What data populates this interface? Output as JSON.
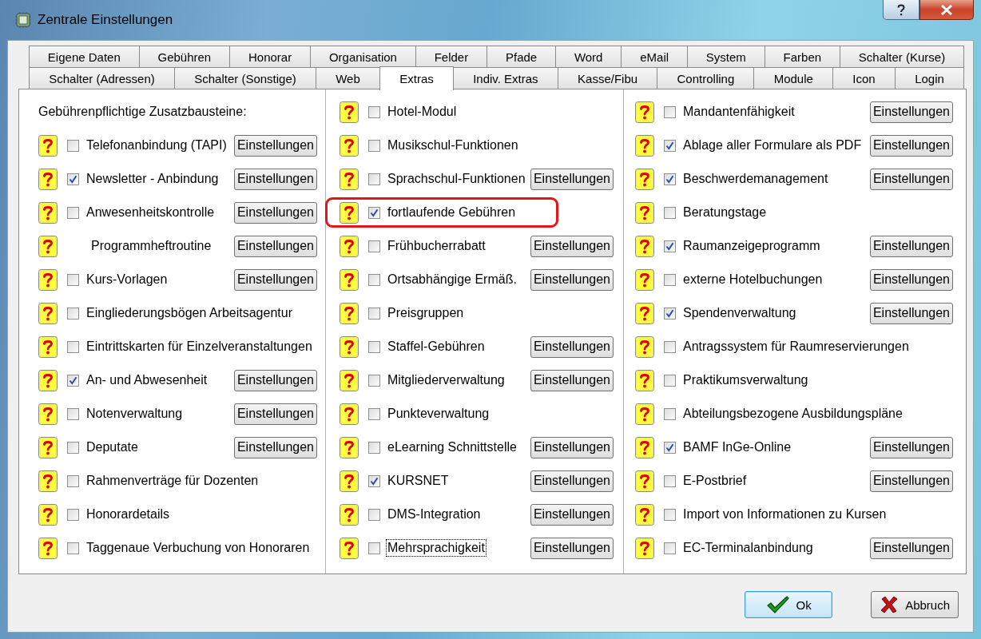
{
  "window": {
    "title": "Zentrale Einstellungen"
  },
  "tabs": [
    [
      {
        "label": "Eigene Daten",
        "selected": false
      },
      {
        "label": "Gebühren",
        "selected": false
      },
      {
        "label": "Honorar",
        "selected": false
      },
      {
        "label": "Organisation",
        "selected": false
      },
      {
        "label": "Felder",
        "selected": false
      },
      {
        "label": "Pfade",
        "selected": false
      },
      {
        "label": "Word",
        "selected": false
      },
      {
        "label": "eMail",
        "selected": false
      },
      {
        "label": "System",
        "selected": false
      },
      {
        "label": "Farben",
        "selected": false
      },
      {
        "label": "Schalter (Kurse)",
        "selected": false
      }
    ],
    [
      {
        "label": "Schalter (Adressen)",
        "selected": false
      },
      {
        "label": "Schalter (Sonstige)",
        "selected": false
      },
      {
        "label": "Web",
        "selected": false
      },
      {
        "label": "Extras",
        "selected": true
      },
      {
        "label": "Indiv. Extras",
        "selected": false
      },
      {
        "label": "Kasse/Fibu",
        "selected": false
      },
      {
        "label": "Controlling",
        "selected": false
      },
      {
        "label": "Module",
        "selected": false
      },
      {
        "label": "Icon",
        "selected": false
      },
      {
        "label": "Login",
        "selected": false
      }
    ]
  ],
  "columns": [
    {
      "header": "Gebührenpflichtige Zusatzbausteine:",
      "items": [
        {
          "kind": "checkbox",
          "label": "Telefonanbindung (TAPI)",
          "checked": false,
          "highlighted": false,
          "focused": false,
          "button": "Einstellungen"
        },
        {
          "kind": "checkbox",
          "label": "Newsletter - Anbindung",
          "checked": true,
          "highlighted": false,
          "focused": false,
          "button": "Einstellungen"
        },
        {
          "kind": "checkbox",
          "label": "Anwesenheitskontrolle",
          "checked": false,
          "highlighted": false,
          "focused": false,
          "button": "Einstellungen"
        },
        {
          "kind": "plain",
          "label": "Programmheftroutine",
          "highlighted": false,
          "focused": false,
          "button": "Einstellungen"
        },
        {
          "kind": "checkbox",
          "label": "Kurs-Vorlagen",
          "checked": false,
          "highlighted": false,
          "focused": false,
          "button": "Einstellungen"
        },
        {
          "kind": "checkbox",
          "label": "Eingliederungsbögen Arbeitsagentur",
          "checked": false,
          "highlighted": false,
          "focused": false
        },
        {
          "kind": "checkbox",
          "label": "Eintrittskarten für Einzelveranstaltungen",
          "checked": false,
          "highlighted": false,
          "focused": false
        },
        {
          "kind": "checkbox",
          "label": "An- und Abwesenheit",
          "checked": true,
          "highlighted": false,
          "focused": false,
          "button": "Einstellungen"
        },
        {
          "kind": "checkbox",
          "label": "Notenverwaltung",
          "checked": false,
          "highlighted": false,
          "focused": false,
          "button": "Einstellungen"
        },
        {
          "kind": "checkbox",
          "label": "Deputate",
          "checked": false,
          "highlighted": false,
          "focused": false,
          "button": "Einstellungen"
        },
        {
          "kind": "checkbox",
          "label": "Rahmenverträge für Dozenten",
          "checked": false,
          "highlighted": false,
          "focused": false
        },
        {
          "kind": "checkbox",
          "label": "Honorardetails",
          "checked": false,
          "highlighted": false,
          "focused": false
        },
        {
          "kind": "checkbox",
          "label": "Taggenaue Verbuchung von Honoraren",
          "checked": false,
          "highlighted": false,
          "focused": false
        }
      ]
    },
    {
      "items": [
        {
          "kind": "checkbox",
          "label": "Hotel-Modul",
          "checked": false,
          "highlighted": false,
          "focused": false
        },
        {
          "kind": "checkbox",
          "label": "Musikschul-Funktionen",
          "checked": false,
          "highlighted": false,
          "focused": false
        },
        {
          "kind": "checkbox",
          "label": "Sprachschul-Funktionen",
          "checked": false,
          "highlighted": false,
          "focused": false,
          "button": "Einstellungen"
        },
        {
          "kind": "checkbox",
          "label": "fortlaufende Gebühren",
          "checked": true,
          "highlighted": true,
          "focused": false
        },
        {
          "kind": "checkbox",
          "label": "Frühbucherrabatt",
          "checked": false,
          "highlighted": false,
          "focused": false,
          "button": "Einstellungen"
        },
        {
          "kind": "checkbox",
          "label": "Ortsabhängige Ermäß.",
          "checked": false,
          "highlighted": false,
          "focused": false,
          "button": "Einstellungen"
        },
        {
          "kind": "checkbox",
          "label": "Preisgruppen",
          "checked": false,
          "highlighted": false,
          "focused": false
        },
        {
          "kind": "checkbox",
          "label": "Staffel-Gebühren",
          "checked": false,
          "highlighted": false,
          "focused": false,
          "button": "Einstellungen"
        },
        {
          "kind": "checkbox",
          "label": "Mitgliederverwaltung",
          "checked": false,
          "highlighted": false,
          "focused": false,
          "button": "Einstellungen"
        },
        {
          "kind": "checkbox",
          "label": "Punkteverwaltung",
          "checked": false,
          "highlighted": false,
          "focused": false
        },
        {
          "kind": "checkbox",
          "label": "eLearning Schnittstelle",
          "checked": false,
          "highlighted": false,
          "focused": false,
          "button": "Einstellungen"
        },
        {
          "kind": "checkbox",
          "label": "KURSNET",
          "checked": true,
          "highlighted": false,
          "focused": false,
          "button": "Einstellungen"
        },
        {
          "kind": "checkbox",
          "label": "DMS-Integration",
          "checked": false,
          "highlighted": false,
          "focused": false,
          "button": "Einstellungen"
        },
        {
          "kind": "checkbox",
          "label": "Mehrsprachigkeit",
          "checked": false,
          "highlighted": false,
          "focused": true,
          "button": "Einstellungen"
        }
      ]
    },
    {
      "items": [
        {
          "kind": "checkbox",
          "label": "Mandantenfähigkeit",
          "checked": false,
          "highlighted": false,
          "focused": false,
          "button": "Einstellungen"
        },
        {
          "kind": "checkbox",
          "label": "Ablage aller Formulare als PDF",
          "checked": true,
          "highlighted": false,
          "focused": false,
          "button": "Einstellungen"
        },
        {
          "kind": "checkbox",
          "label": "Beschwerdemanagement",
          "checked": true,
          "highlighted": false,
          "focused": false,
          "button": "Einstellungen"
        },
        {
          "kind": "checkbox",
          "label": "Beratungstage",
          "checked": false,
          "highlighted": false,
          "focused": false
        },
        {
          "kind": "checkbox",
          "label": "Raumanzeigeprogramm",
          "checked": true,
          "highlighted": false,
          "focused": false,
          "button": "Einstellungen"
        },
        {
          "kind": "checkbox",
          "label": "externe Hotelbuchungen",
          "checked": false,
          "highlighted": false,
          "focused": false,
          "button": "Einstellungen"
        },
        {
          "kind": "checkbox",
          "label": "Spendenverwaltung",
          "checked": true,
          "highlighted": false,
          "focused": false,
          "button": "Einstellungen"
        },
        {
          "kind": "checkbox",
          "label": "Antragssystem für Raumreservierungen",
          "checked": false,
          "highlighted": false,
          "focused": false
        },
        {
          "kind": "checkbox",
          "label": "Praktikumsverwaltung",
          "checked": false,
          "highlighted": false,
          "focused": false
        },
        {
          "kind": "checkbox",
          "label": "Abteilungsbezogene Ausbildungspläne",
          "checked": false,
          "highlighted": false,
          "focused": false
        },
        {
          "kind": "checkbox",
          "label": "BAMF InGe-Online",
          "checked": true,
          "highlighted": false,
          "focused": false,
          "button": "Einstellungen"
        },
        {
          "kind": "checkbox",
          "label": "E-Postbrief",
          "checked": false,
          "highlighted": false,
          "focused": false,
          "button": "Einstellungen"
        },
        {
          "kind": "checkbox",
          "label": "Import von Informationen zu Kursen",
          "checked": false,
          "highlighted": false,
          "focused": false
        },
        {
          "kind": "checkbox",
          "label": "EC-Terminalanbindung",
          "checked": false,
          "highlighted": false,
          "focused": false,
          "button": "Einstellungen"
        }
      ]
    }
  ],
  "buttons": [
    {
      "label": "Ok",
      "default": true
    },
    {
      "label": "Abbruch",
      "default": false
    }
  ]
}
